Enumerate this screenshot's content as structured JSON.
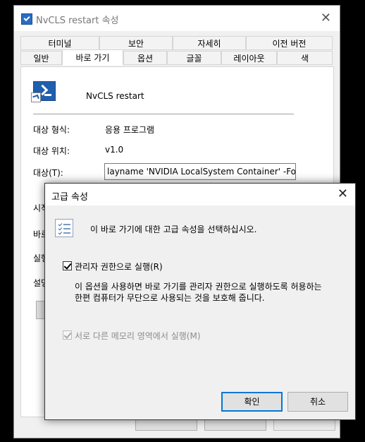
{
  "properties_window": {
    "title": "NvCLS restart 속성",
    "close_glyph": "✕",
    "tabs_row1": [
      "터미널",
      "보안",
      "자세히",
      "이전 버전"
    ],
    "tabs_row2": [
      "일반",
      "바로 가기",
      "옵션",
      "글꼴",
      "레이아웃",
      "색"
    ],
    "active_tab": "바로 가기",
    "shortcut_name": "NvCLS restart",
    "fields": [
      {
        "label": "대상 형식:",
        "value": "응용 프로그램"
      },
      {
        "label": "대상 위치:",
        "value": "v1.0"
      }
    ],
    "target_label": "대상(T):",
    "target_value": "layname 'NVIDIA LocalSystem Container' -Force\"",
    "clipped_labels": [
      "시작",
      "바로",
      "실행",
      "설명"
    ]
  },
  "dialog": {
    "title": "고급 속성",
    "close_glyph": "✕",
    "heading": "이 바로 가기에 대한 고급 속성을 선택하십시오.",
    "run_as_admin": {
      "label": "관리자 권한으로 실행(R)",
      "checked": true,
      "enabled": true
    },
    "description": "이 옵션을 사용하면 바로 가기를 관리자 권한으로 실행하도록 허용하는 한편 컴퓨터가 무단으로 사용되는 것을 보호해 줍니다.",
    "separate_memory": {
      "label": "서로 다른 메모리 영역에서 실행(M)",
      "checked": true,
      "enabled": false
    },
    "ok_label": "확인",
    "cancel_label": "취소"
  },
  "colors": {
    "accent": "#0078d7",
    "window_bg": "#f0f0f0",
    "disabled_text": "#8d8d8d"
  }
}
